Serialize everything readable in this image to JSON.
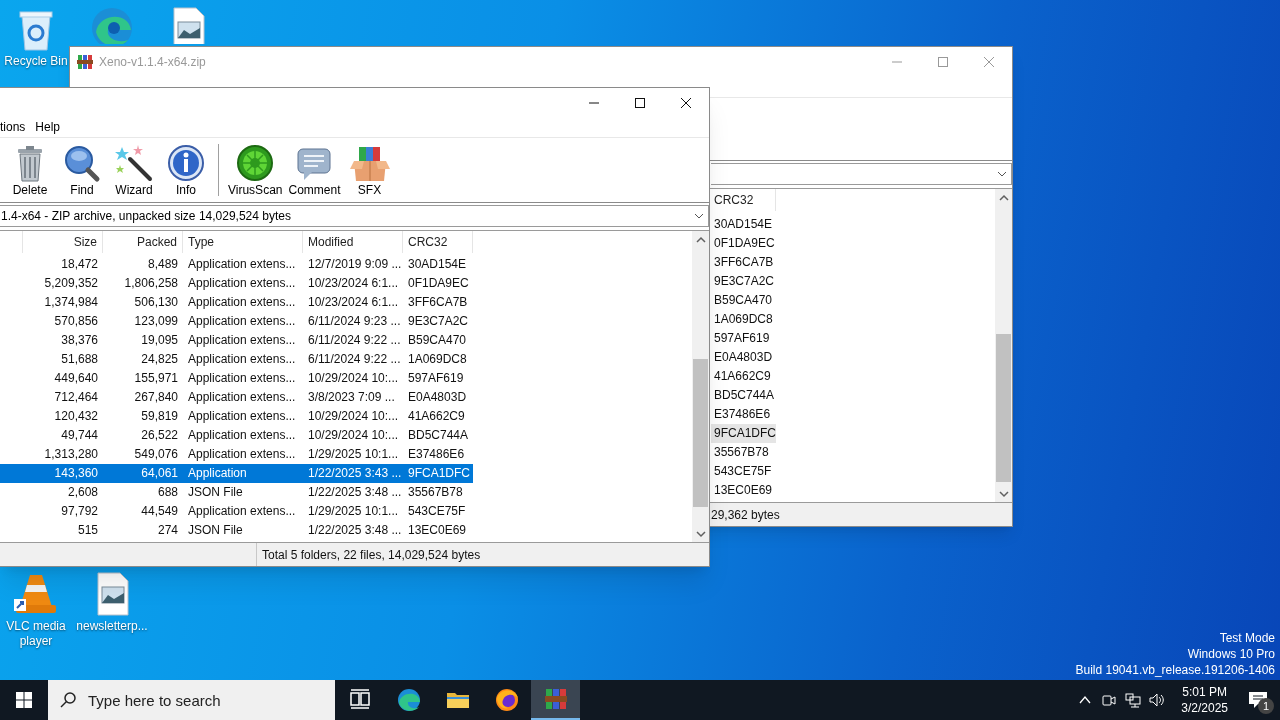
{
  "desktop": {
    "icons": [
      {
        "kind": "recycle",
        "label": "Recycle Bin"
      },
      {
        "kind": "edge"
      },
      {
        "kind": "image"
      },
      {
        "kind": "vlc",
        "label": "VLC media player"
      },
      {
        "kind": "image",
        "label": "newsletterp..."
      }
    ],
    "system_text": [
      "Test Mode",
      "Windows 10 Pro",
      "Build 19041.vb_release.191206-1406"
    ]
  },
  "back_window": {
    "title": "Xeno-v1.1.4-x64.zip",
    "list": {
      "column": "CRC32",
      "rows": [
        {
          "crc": "30AD154E",
          "selected": false
        },
        {
          "crc": "0F1DA9EC",
          "selected": false
        },
        {
          "crc": "3FF6CA7B",
          "selected": false
        },
        {
          "crc": "9E3C7A2C",
          "selected": false
        },
        {
          "crc": "B59CA470",
          "selected": false
        },
        {
          "crc": "1A069DC8",
          "selected": false
        },
        {
          "crc": "597AF619",
          "selected": false
        },
        {
          "crc": "E0A4803D",
          "selected": false
        },
        {
          "crc": "41A662C9",
          "selected": false
        },
        {
          "crc": "BD5C744A",
          "selected": false
        },
        {
          "crc": "E37486E6",
          "selected": false
        },
        {
          "crc": "9FCA1DFC",
          "selected": true
        },
        {
          "crc": "35567B78",
          "selected": false
        },
        {
          "crc": "543CE75F",
          "selected": false
        },
        {
          "crc": "13EC0E69",
          "selected": false
        }
      ]
    },
    "status": "29,362 bytes"
  },
  "front_window": {
    "menu": [
      "tions",
      "Help"
    ],
    "toolbar": [
      {
        "kind": "delete",
        "label": "Delete"
      },
      {
        "kind": "find",
        "label": "Find"
      },
      {
        "kind": "wizard",
        "label": "Wizard"
      },
      {
        "kind": "info",
        "label": "Info"
      },
      {
        "kind": "separator"
      },
      {
        "kind": "virusscan",
        "label": "VirusScan"
      },
      {
        "kind": "comment",
        "label": "Comment"
      },
      {
        "kind": "sfx",
        "label": "SFX"
      }
    ],
    "address": "1.4-x64 - ZIP archive, unpacked size 14,029,524 bytes",
    "columns": [
      "Size",
      "Packed",
      "Type",
      "Modified",
      "CRC32"
    ],
    "rows": [
      {
        "size": "18,472",
        "packed": "8,489",
        "type": "Application extens...",
        "modified": "12/7/2019 9:09 ...",
        "crc": "30AD154E",
        "selected": false
      },
      {
        "size": "5,209,352",
        "packed": "1,806,258",
        "type": "Application extens...",
        "modified": "10/23/2024 6:1...",
        "crc": "0F1DA9EC",
        "selected": false
      },
      {
        "size": "1,374,984",
        "packed": "506,130",
        "type": "Application extens...",
        "modified": "10/23/2024 6:1...",
        "crc": "3FF6CA7B",
        "selected": false
      },
      {
        "size": "570,856",
        "packed": "123,099",
        "type": "Application extens...",
        "modified": "6/11/2024 9:23 ...",
        "crc": "9E3C7A2C",
        "selected": false
      },
      {
        "size": "38,376",
        "packed": "19,095",
        "type": "Application extens...",
        "modified": "6/11/2024 9:22 ...",
        "crc": "B59CA470",
        "selected": false
      },
      {
        "size": "51,688",
        "packed": "24,825",
        "type": "Application extens...",
        "modified": "6/11/2024 9:22 ...",
        "crc": "1A069DC8",
        "selected": false
      },
      {
        "size": "449,640",
        "packed": "155,971",
        "type": "Application extens...",
        "modified": "10/29/2024 10:...",
        "crc": "597AF619",
        "selected": false
      },
      {
        "size": "712,464",
        "packed": "267,840",
        "type": "Application extens...",
        "modified": "3/8/2023 7:09 ...",
        "crc": "E0A4803D",
        "selected": false
      },
      {
        "size": "120,432",
        "packed": "59,819",
        "type": "Application extens...",
        "modified": "10/29/2024 10:...",
        "crc": "41A662C9",
        "selected": false
      },
      {
        "size": "49,744",
        "packed": "26,522",
        "type": "Application extens...",
        "modified": "10/29/2024 10:...",
        "crc": "BD5C744A",
        "selected": false
      },
      {
        "size": "1,313,280",
        "packed": "549,076",
        "type": "Application extens...",
        "modified": "1/29/2025 10:1...",
        "crc": "E37486E6",
        "selected": false
      },
      {
        "size": "143,360",
        "packed": "64,061",
        "type": "Application",
        "modified": "1/22/2025 3:43 ...",
        "crc": "9FCA1DFC",
        "selected": true
      },
      {
        "size": "2,608",
        "packed": "688",
        "type": "JSON File",
        "modified": "1/22/2025 3:48 ...",
        "crc": "35567B78",
        "selected": false
      },
      {
        "size": "97,792",
        "packed": "44,549",
        "type": "Application extens...",
        "modified": "1/29/2025 10:1...",
        "crc": "543CE75F",
        "selected": false
      },
      {
        "size": "515",
        "packed": "274",
        "type": "JSON File",
        "modified": "1/22/2025 3:48 ...",
        "crc": "13EC0E69",
        "selected": false
      }
    ],
    "status": "Total 5 folders, 22 files, 14,029,524 bytes"
  },
  "taskbar": {
    "search_placeholder": "Type here to search",
    "apps": [
      {
        "kind": "taskview",
        "active": false
      },
      {
        "kind": "edge",
        "active": false
      },
      {
        "kind": "folder",
        "active": false
      },
      {
        "kind": "firefox",
        "active": false
      },
      {
        "kind": "winrar",
        "active": true
      }
    ],
    "tray": [
      {
        "kind": "chevron"
      },
      {
        "kind": "camera"
      },
      {
        "kind": "network"
      },
      {
        "kind": "volume"
      }
    ],
    "time": "5:01 PM",
    "date": "3/2/2025",
    "notifications": "1"
  }
}
